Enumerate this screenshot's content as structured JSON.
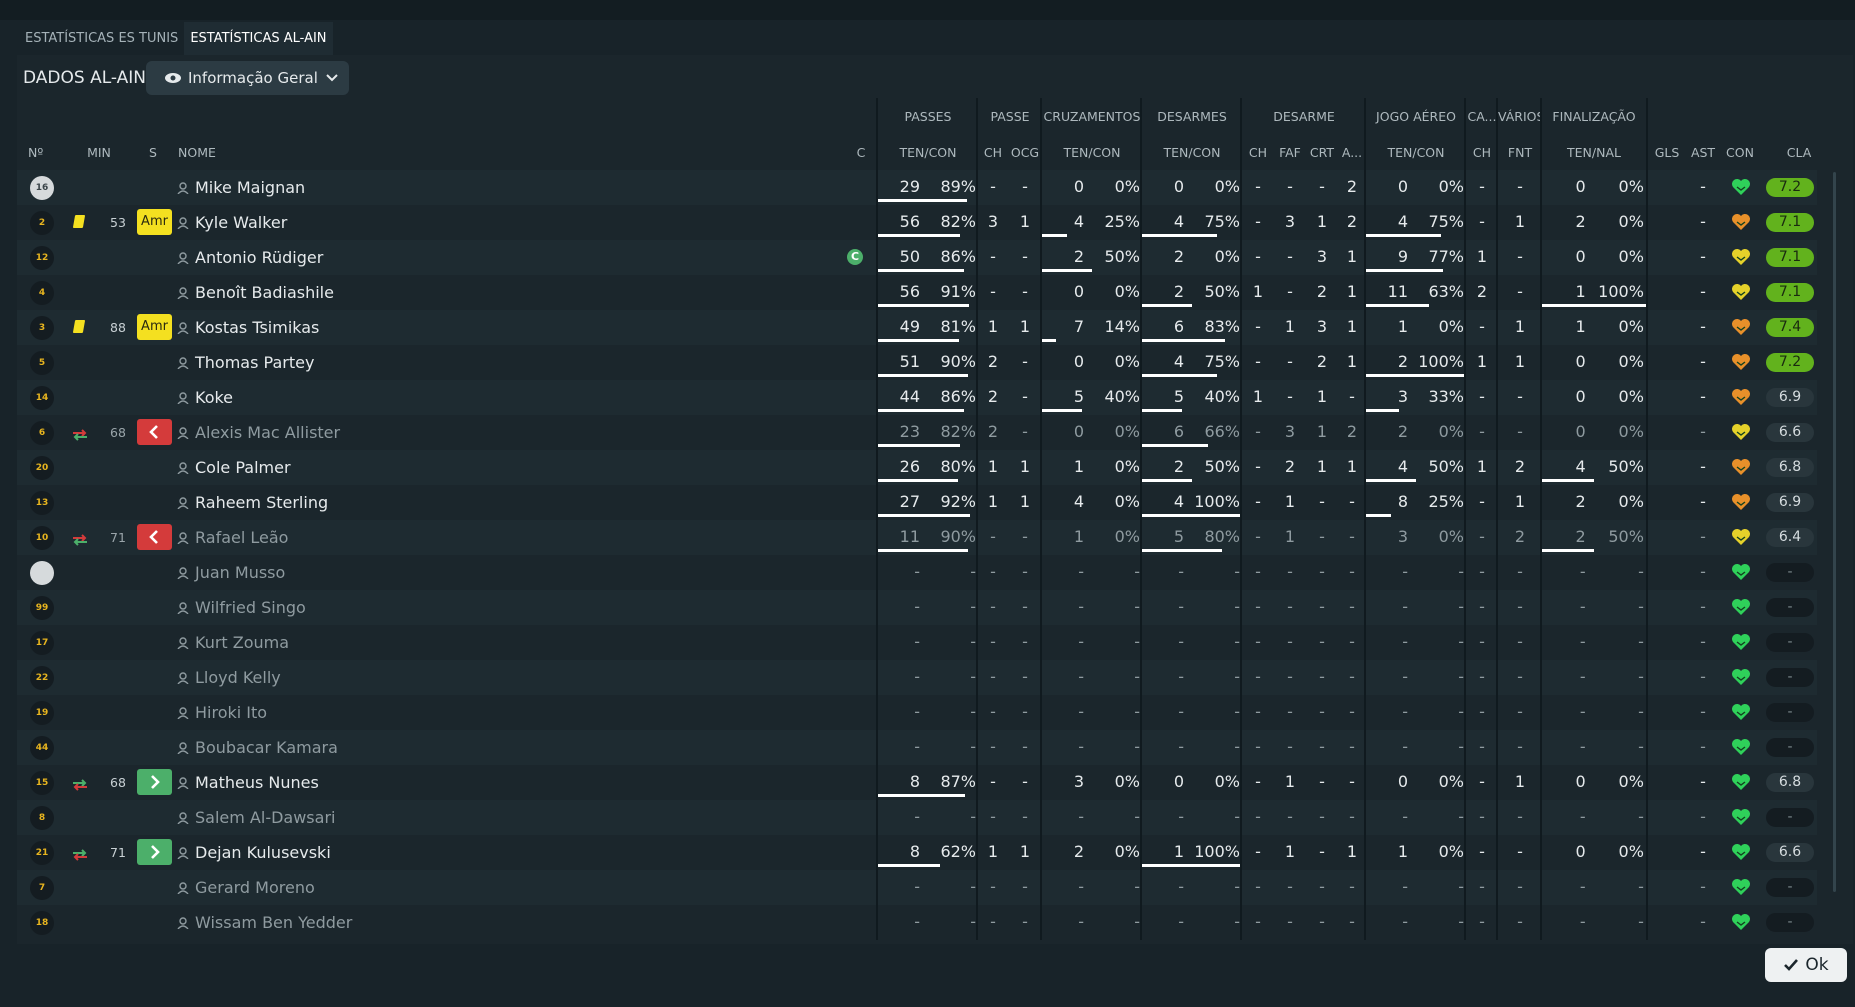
{
  "tabs": [
    {
      "label": "ESTATÍSTICAS ES TUNIS",
      "active": false
    },
    {
      "label": "ESTATÍSTICAS AL-AIN",
      "active": true
    }
  ],
  "panel_title": "DADOS AL-AIN",
  "view_selector": {
    "label": "Informação Geral",
    "icon": "eye-icon"
  },
  "group_headers": [
    "PASSES",
    "PASSE",
    "CRUZAMENTOS",
    "DESARMES",
    "DESARME",
    "JOGO AÉREO",
    "CA...",
    "VÁRIOS",
    "FINALIZAÇÃO"
  ],
  "column_headers": {
    "num": "Nº",
    "min": "MIN",
    "s": "S",
    "name": "NOME",
    "c": "C",
    "passes": "TEN/CON",
    "passe_ch": "CH",
    "passe_ocg": "OCG",
    "cruz": "TEN/CON",
    "desarmes": "TEN/CON",
    "des_ch": "CH",
    "des_faf": "FAF",
    "des_crt": "CRT",
    "des_a": "A...",
    "aereo": "TEN/CON",
    "ca_ch": "CH",
    "varios_fnt": "FNT",
    "final": "TEN/NAL",
    "gls": "GLS",
    "ast": "AST",
    "con": "CON",
    "cla": "CLA"
  },
  "colors": {
    "rating_high": "#62b21d",
    "yellow_card": "#f4e020",
    "sub_out": "#d43b3b",
    "sub_in": "#4caf6a",
    "condition_green": "#2fd15a",
    "condition_orange": "#e8902a",
    "condition_yellow": "#e5d12a"
  },
  "players": [
    {
      "num": "16",
      "gk": true,
      "name": "Mike Maignan",
      "pas_t": "29",
      "pas_p": "89%",
      "pas_f": 0.89,
      "pch": "-",
      "ocg": "-",
      "cru_t": "0",
      "cru_p": "0%",
      "cru_f": 0,
      "des_t": "0",
      "des_p": "0%",
      "des_f": 0,
      "dch": "-",
      "faf": "-",
      "crt": "-",
      "da": "2",
      "aer_t": "0",
      "aer_p": "0%",
      "aer_f": 0,
      "cch": "-",
      "fnt": "-",
      "fin_t": "0",
      "fin_p": "0%",
      "fin_f": 0,
      "gls": "",
      "ast": "-",
      "con": "green",
      "con_icon": "heart-icon",
      "cla": "7.2",
      "cla_style": "hi",
      "dim": false
    },
    {
      "num": "2",
      "gk": false,
      "min": "53",
      "yellow": true,
      "s_label": "Amr",
      "name": "Kyle Walker",
      "pas_t": "56",
      "pas_p": "82%",
      "pas_f": 0.82,
      "pch": "3",
      "ocg": "1",
      "cru_t": "4",
      "cru_p": "25%",
      "cru_f": 0.25,
      "des_t": "4",
      "des_p": "75%",
      "des_f": 0.75,
      "dch": "-",
      "faf": "3",
      "crt": "1",
      "da": "2",
      "aer_t": "4",
      "aer_p": "75%",
      "aer_f": 0.75,
      "cch": "-",
      "fnt": "1",
      "fin_t": "2",
      "fin_p": "0%",
      "fin_f": 0,
      "gls": "",
      "ast": "-",
      "con": "orange",
      "con_icon": "heart-icon",
      "cla": "7.1",
      "cla_style": "hi",
      "dim": false
    },
    {
      "num": "12",
      "gk": false,
      "name": "Antonio Rüdiger",
      "captain": "C",
      "pas_t": "50",
      "pas_p": "86%",
      "pas_f": 0.86,
      "pch": "-",
      "ocg": "-",
      "cru_t": "2",
      "cru_p": "50%",
      "cru_f": 0.5,
      "des_t": "2",
      "des_p": "0%",
      "des_f": 0,
      "dch": "-",
      "faf": "-",
      "crt": "3",
      "da": "1",
      "aer_t": "9",
      "aer_p": "77%",
      "aer_f": 0.77,
      "cch": "1",
      "fnt": "-",
      "fin_t": "0",
      "fin_p": "0%",
      "fin_f": 0,
      "gls": "",
      "ast": "-",
      "con": "yellow",
      "con_icon": "heart-icon",
      "cla": "7.1",
      "cla_style": "hi",
      "dim": false
    },
    {
      "num": "4",
      "gk": false,
      "name": "Benoît Badiashile",
      "pas_t": "56",
      "pas_p": "91%",
      "pas_f": 0.91,
      "pch": "-",
      "ocg": "-",
      "cru_t": "0",
      "cru_p": "0%",
      "cru_f": 0,
      "des_t": "2",
      "des_p": "50%",
      "des_f": 0.5,
      "dch": "1",
      "faf": "-",
      "crt": "2",
      "da": "1",
      "aer_t": "11",
      "aer_p": "63%",
      "aer_f": 0.63,
      "cch": "2",
      "fnt": "-",
      "fin_t": "1",
      "fin_p": "100%",
      "fin_f": 1,
      "gls": "",
      "ast": "-",
      "con": "yellow",
      "con_icon": "heart-icon",
      "cla": "7.1",
      "cla_style": "hi",
      "dim": false
    },
    {
      "num": "3",
      "gk": false,
      "min": "88",
      "yellow": true,
      "s_label": "Amr",
      "name": "Kostas Tsimikas",
      "pas_t": "49",
      "pas_p": "81%",
      "pas_f": 0.81,
      "pch": "1",
      "ocg": "1",
      "cru_t": "7",
      "cru_p": "14%",
      "cru_f": 0.14,
      "des_t": "6",
      "des_p": "83%",
      "des_f": 0.83,
      "dch": "-",
      "faf": "1",
      "crt": "3",
      "da": "1",
      "aer_t": "1",
      "aer_p": "0%",
      "aer_f": 0,
      "cch": "-",
      "fnt": "1",
      "fin_t": "1",
      "fin_p": "0%",
      "fin_f": 0,
      "gls": "",
      "ast": "-",
      "con": "orange",
      "con_icon": "heart-icon",
      "cla": "7.4",
      "cla_style": "hi",
      "dim": false
    },
    {
      "num": "5",
      "gk": false,
      "name": "Thomas Partey",
      "pas_t": "51",
      "pas_p": "90%",
      "pas_f": 0.9,
      "pch": "2",
      "ocg": "-",
      "cru_t": "0",
      "cru_p": "0%",
      "cru_f": 0,
      "des_t": "4",
      "des_p": "75%",
      "des_f": 0.75,
      "dch": "-",
      "faf": "-",
      "crt": "2",
      "da": "1",
      "aer_t": "2",
      "aer_p": "100%",
      "aer_f": 1,
      "cch": "1",
      "fnt": "1",
      "fin_t": "0",
      "fin_p": "0%",
      "fin_f": 0,
      "gls": "",
      "ast": "-",
      "con": "orange",
      "con_icon": "heart-icon",
      "cla": "7.2",
      "cla_style": "hi",
      "dim": false
    },
    {
      "num": "14",
      "gk": false,
      "name": "Koke",
      "pas_t": "44",
      "pas_p": "86%",
      "pas_f": 0.86,
      "pch": "2",
      "ocg": "-",
      "cru_t": "5",
      "cru_p": "40%",
      "cru_f": 0.4,
      "des_t": "5",
      "des_p": "40%",
      "des_f": 0.4,
      "dch": "1",
      "faf": "-",
      "crt": "1",
      "da": "-",
      "aer_t": "3",
      "aer_p": "33%",
      "aer_f": 0.33,
      "cch": "-",
      "fnt": "-",
      "fin_t": "0",
      "fin_p": "0%",
      "fin_f": 0,
      "gls": "",
      "ast": "-",
      "con": "orange",
      "con_icon": "heart-icon",
      "cla": "6.9",
      "cla_style": "mid",
      "dim": false
    },
    {
      "num": "6",
      "gk": false,
      "min": "68",
      "sub": "out",
      "name": "Alexis Mac Allister",
      "pas_t": "23",
      "pas_p": "82%",
      "pas_f": 0.82,
      "pch": "2",
      "ocg": "-",
      "cru_t": "0",
      "cru_p": "0%",
      "cru_f": 0,
      "des_t": "6",
      "des_p": "66%",
      "des_f": 0.66,
      "dch": "-",
      "faf": "3",
      "crt": "1",
      "da": "2",
      "aer_t": "2",
      "aer_p": "0%",
      "aer_f": 0,
      "cch": "-",
      "fnt": "-",
      "fin_t": "0",
      "fin_p": "0%",
      "fin_f": 0,
      "gls": "",
      "ast": "-",
      "con": "yellow",
      "con_icon": "heart-icon",
      "cla": "6.6",
      "cla_style": "mid",
      "dim": true
    },
    {
      "num": "20",
      "gk": false,
      "name": "Cole Palmer",
      "pas_t": "26",
      "pas_p": "80%",
      "pas_f": 0.8,
      "pch": "1",
      "ocg": "1",
      "cru_t": "1",
      "cru_p": "0%",
      "cru_f": 0,
      "des_t": "2",
      "des_p": "50%",
      "des_f": 0.5,
      "dch": "-",
      "faf": "2",
      "crt": "1",
      "da": "1",
      "aer_t": "4",
      "aer_p": "50%",
      "aer_f": 0.5,
      "cch": "1",
      "fnt": "2",
      "fin_t": "4",
      "fin_p": "50%",
      "fin_f": 0.5,
      "gls": "",
      "ast": "-",
      "con": "orange",
      "con_icon": "heart-icon",
      "cla": "6.8",
      "cla_style": "mid",
      "dim": false
    },
    {
      "num": "13",
      "gk": false,
      "name": "Raheem Sterling",
      "pas_t": "27",
      "pas_p": "92%",
      "pas_f": 0.92,
      "pch": "1",
      "ocg": "1",
      "cru_t": "4",
      "cru_p": "0%",
      "cru_f": 0,
      "des_t": "4",
      "des_p": "100%",
      "des_f": 1,
      "dch": "-",
      "faf": "1",
      "crt": "-",
      "da": "-",
      "aer_t": "8",
      "aer_p": "25%",
      "aer_f": 0.25,
      "cch": "-",
      "fnt": "1",
      "fin_t": "2",
      "fin_p": "0%",
      "fin_f": 0,
      "gls": "",
      "ast": "-",
      "con": "orange",
      "con_icon": "heart-icon",
      "cla": "6.9",
      "cla_style": "mid",
      "dim": false
    },
    {
      "num": "10",
      "gk": false,
      "min": "71",
      "sub": "out",
      "name": "Rafael Leão",
      "pas_t": "11",
      "pas_p": "90%",
      "pas_f": 0.9,
      "pch": "-",
      "ocg": "-",
      "cru_t": "1",
      "cru_p": "0%",
      "cru_f": 0,
      "des_t": "5",
      "des_p": "80%",
      "des_f": 0.8,
      "dch": "-",
      "faf": "1",
      "crt": "-",
      "da": "-",
      "aer_t": "3",
      "aer_p": "0%",
      "aer_f": 0,
      "cch": "-",
      "fnt": "2",
      "fin_t": "2",
      "fin_p": "50%",
      "fin_f": 0.5,
      "gls": "",
      "ast": "-",
      "con": "yellow",
      "con_icon": "heart-icon",
      "cla": "6.4",
      "cla_style": "mid",
      "dim": true
    },
    {
      "num": "",
      "gk": true,
      "name": "Juan Musso",
      "empty": true,
      "gls": "",
      "ast": "-",
      "con": "green",
      "con_icon": "heart-icon",
      "cla": "-",
      "cla_style": "none",
      "dim": true
    },
    {
      "num": "99",
      "gk": false,
      "name": "Wilfried Singo",
      "empty": true,
      "gls": "",
      "ast": "-",
      "con": "green",
      "con_icon": "heart-icon",
      "cla": "-",
      "cla_style": "none",
      "dim": true
    },
    {
      "num": "17",
      "gk": false,
      "name": "Kurt Zouma",
      "empty": true,
      "gls": "",
      "ast": "-",
      "con": "green",
      "con_icon": "heart-icon",
      "cla": "-",
      "cla_style": "none",
      "dim": true
    },
    {
      "num": "22",
      "gk": false,
      "name": "Lloyd Kelly",
      "empty": true,
      "gls": "",
      "ast": "-",
      "con": "green",
      "con_icon": "heart-icon",
      "cla": "-",
      "cla_style": "none",
      "dim": true
    },
    {
      "num": "19",
      "gk": false,
      "name": "Hiroki Ito",
      "empty": true,
      "gls": "",
      "ast": "-",
      "con": "green",
      "con_icon": "heart-icon",
      "cla": "-",
      "cla_style": "none",
      "dim": true
    },
    {
      "num": "44",
      "gk": false,
      "name": "Boubacar Kamara",
      "empty": true,
      "gls": "",
      "ast": "-",
      "con": "green",
      "con_icon": "heart-icon",
      "cla": "-",
      "cla_style": "none",
      "dim": true
    },
    {
      "num": "15",
      "gk": false,
      "min": "68",
      "sub": "in",
      "name": "Matheus Nunes",
      "pas_t": "8",
      "pas_p": "87%",
      "pas_f": 0.87,
      "pch": "-",
      "ocg": "-",
      "cru_t": "3",
      "cru_p": "0%",
      "cru_f": 0,
      "des_t": "0",
      "des_p": "0%",
      "des_f": 0,
      "dch": "-",
      "faf": "1",
      "crt": "-",
      "da": "-",
      "aer_t": "0",
      "aer_p": "0%",
      "aer_f": 0,
      "cch": "-",
      "fnt": "1",
      "fin_t": "0",
      "fin_p": "0%",
      "fin_f": 0,
      "gls": "",
      "ast": "-",
      "con": "green",
      "con_icon": "heart-icon",
      "cla": "6.8",
      "cla_style": "mid",
      "dim": false
    },
    {
      "num": "8",
      "gk": false,
      "name": "Salem Al-Dawsari",
      "empty": true,
      "gls": "",
      "ast": "-",
      "con": "green",
      "con_icon": "heart-icon",
      "cla": "-",
      "cla_style": "none",
      "dim": true
    },
    {
      "num": "21",
      "gk": false,
      "min": "71",
      "sub": "in",
      "name": "Dejan Kulusevski",
      "pas_t": "8",
      "pas_p": "62%",
      "pas_f": 0.62,
      "pch": "1",
      "ocg": "1",
      "cru_t": "2",
      "cru_p": "0%",
      "cru_f": 0,
      "des_t": "1",
      "des_p": "100%",
      "des_f": 1,
      "dch": "-",
      "faf": "1",
      "crt": "-",
      "da": "1",
      "aer_t": "1",
      "aer_p": "0%",
      "aer_f": 0,
      "cch": "-",
      "fnt": "-",
      "fin_t": "0",
      "fin_p": "0%",
      "fin_f": 0,
      "gls": "",
      "ast": "-",
      "con": "green",
      "con_icon": "heart-icon",
      "cla": "6.6",
      "cla_style": "mid",
      "dim": false
    },
    {
      "num": "7",
      "gk": false,
      "name": "Gerard Moreno",
      "empty": true,
      "gls": "",
      "ast": "-",
      "con": "green",
      "con_icon": "heart-icon",
      "cla": "-",
      "cla_style": "none",
      "dim": true
    },
    {
      "num": "18",
      "gk": false,
      "name": "Wissam Ben Yedder",
      "empty": true,
      "gls": "",
      "ast": "-",
      "con": "green",
      "con_icon": "heart-icon",
      "cla": "-",
      "cla_style": "none",
      "dim": true
    }
  ],
  "ok_button": {
    "label": "Ok",
    "icon": "check-icon"
  }
}
